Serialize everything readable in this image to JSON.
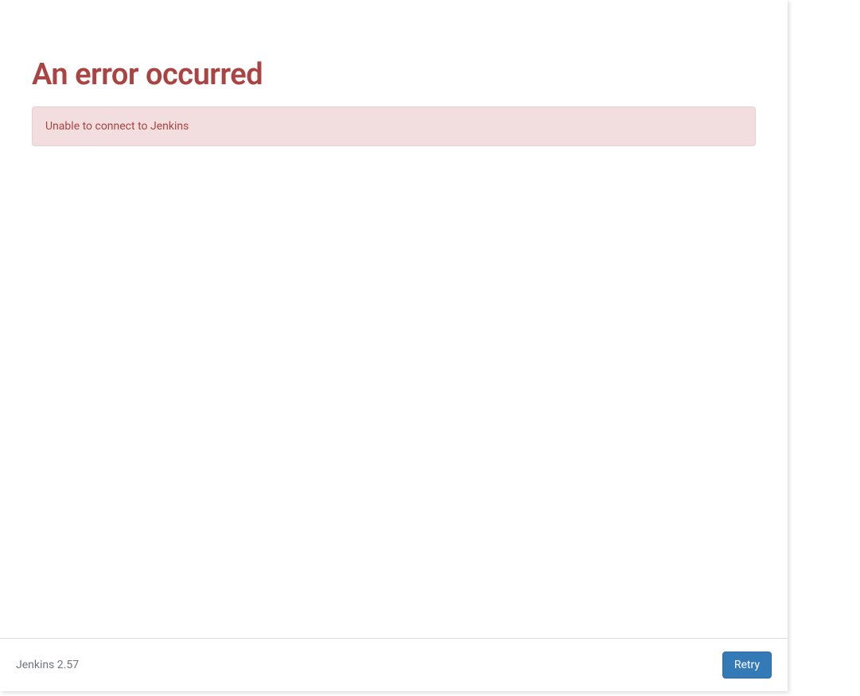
{
  "main": {
    "title": "An error occurred",
    "alert_message": "Unable to connect to Jenkins"
  },
  "footer": {
    "version_label": "Jenkins 2.57",
    "retry_label": "Retry"
  }
}
